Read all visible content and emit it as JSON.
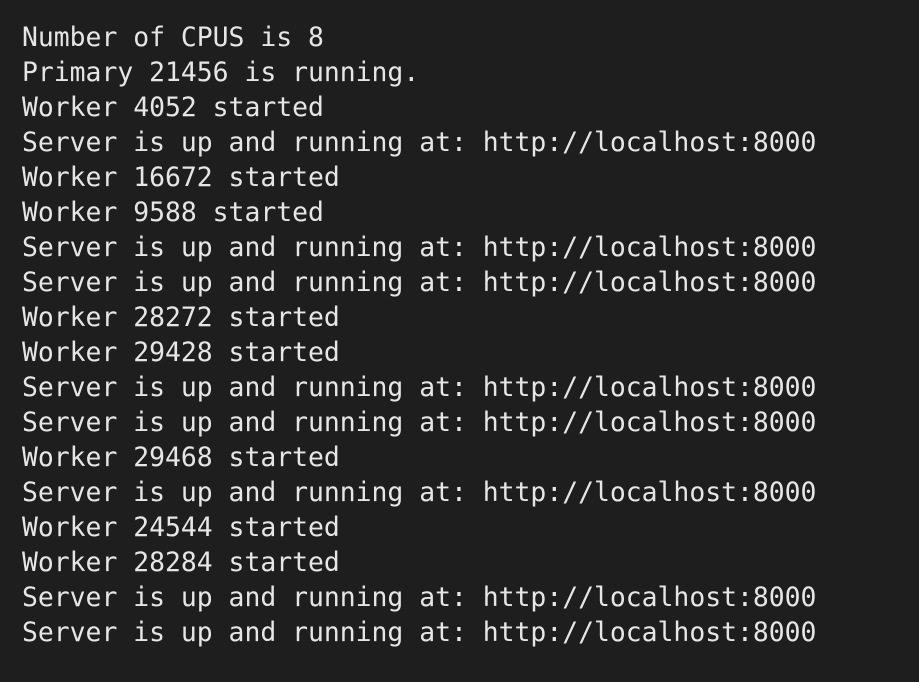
{
  "terminal": {
    "lines": [
      "Number of CPUS is 8",
      "Primary 21456 is running.",
      "Worker 4052 started",
      "Server is up and running at: http://localhost:8000",
      "Worker 16672 started",
      "Worker 9588 started",
      "Server is up and running at: http://localhost:8000",
      "Server is up and running at: http://localhost:8000",
      "Worker 28272 started",
      "Worker 29428 started",
      "Server is up and running at: http://localhost:8000",
      "Server is up and running at: http://localhost:8000",
      "Worker 29468 started",
      "Server is up and running at: http://localhost:8000",
      "Worker 24544 started",
      "Worker 28284 started",
      "Server is up and running at: http://localhost:8000",
      "Server is up and running at: http://localhost:8000"
    ]
  },
  "colors": {
    "background": "#1e1e1e",
    "text": "#e6e6e6"
  }
}
